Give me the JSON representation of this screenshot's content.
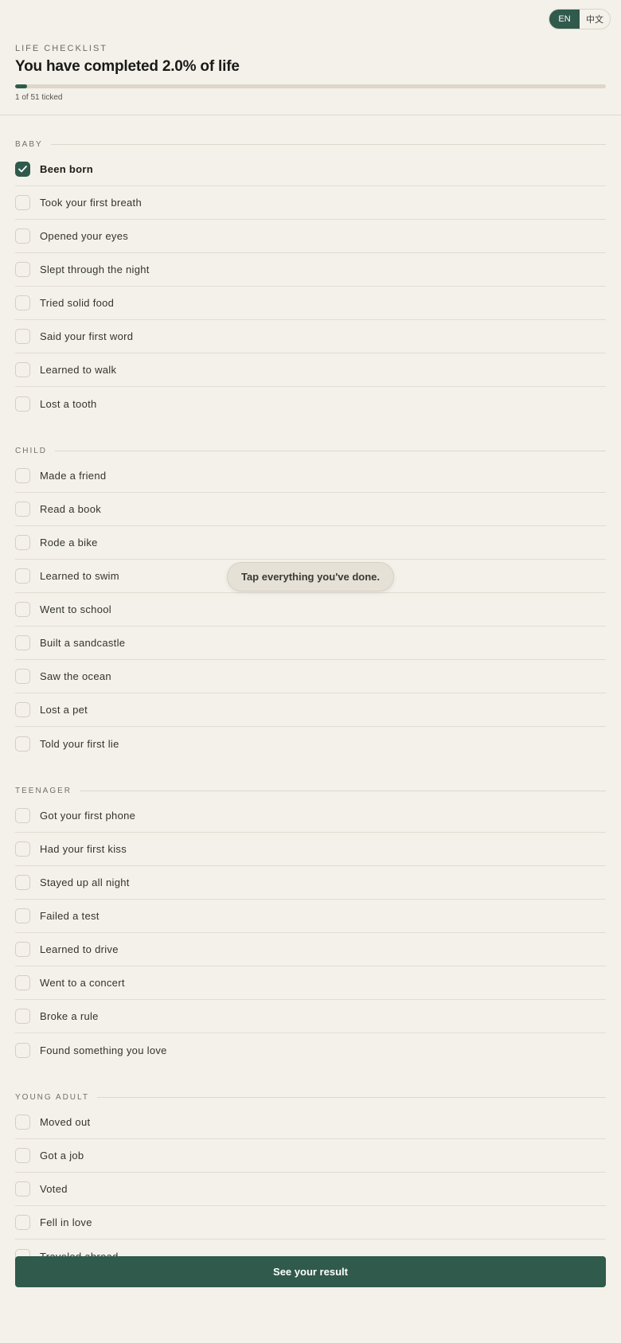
{
  "lang": {
    "en": "EN",
    "zh": "中文",
    "active": "en"
  },
  "header": {
    "eyebrow": "LIFE CHECKLIST",
    "title": "You have completed 2.0% of life",
    "progress_fraction": 0.02,
    "count": "1 of 51 ticked"
  },
  "sections": [
    {
      "label": "BABY",
      "items": [
        {
          "label": "Been born",
          "checked": true
        },
        {
          "label": "Took your first breath",
          "checked": false
        },
        {
          "label": "Opened your eyes",
          "checked": false
        },
        {
          "label": "Slept through the night",
          "checked": false
        },
        {
          "label": "Tried solid food",
          "checked": false
        },
        {
          "label": "Said your first word",
          "checked": false
        },
        {
          "label": "Learned to walk",
          "checked": false
        },
        {
          "label": "Lost a tooth",
          "checked": false
        }
      ]
    },
    {
      "label": "CHILD",
      "items": [
        {
          "label": "Made a friend",
          "checked": false
        },
        {
          "label": "Read a book",
          "checked": false
        },
        {
          "label": "Rode a bike",
          "checked": false
        },
        {
          "label": "Learned to swim",
          "checked": false
        },
        {
          "label": "Went to school",
          "checked": false
        },
        {
          "label": "Built a sandcastle",
          "checked": false
        },
        {
          "label": "Saw the ocean",
          "checked": false
        },
        {
          "label": "Lost a pet",
          "checked": false
        },
        {
          "label": "Told your first lie",
          "checked": false
        }
      ]
    },
    {
      "label": "TEENAGER",
      "items": [
        {
          "label": "Got your first phone",
          "checked": false
        },
        {
          "label": "Had your first kiss",
          "checked": false
        },
        {
          "label": "Stayed up all night",
          "checked": false
        },
        {
          "label": "Failed a test",
          "checked": false
        },
        {
          "label": "Learned to drive",
          "checked": false
        },
        {
          "label": "Went to a concert",
          "checked": false
        },
        {
          "label": "Broke a rule",
          "checked": false
        },
        {
          "label": "Found something you love",
          "checked": false
        }
      ]
    },
    {
      "label": "YOUNG ADULT",
      "items": [
        {
          "label": "Moved out",
          "checked": false
        },
        {
          "label": "Got a job",
          "checked": false
        },
        {
          "label": "Voted",
          "checked": false
        },
        {
          "label": "Fell in love",
          "checked": false
        },
        {
          "label": "Traveled abroad",
          "checked": false
        }
      ]
    }
  ],
  "toast": "Tap everything you've done.",
  "result_button": "See your result",
  "colors": {
    "accent": "#2f5a4c",
    "background": "#f4f1ea"
  },
  "icons": {
    "check": "check-icon"
  }
}
